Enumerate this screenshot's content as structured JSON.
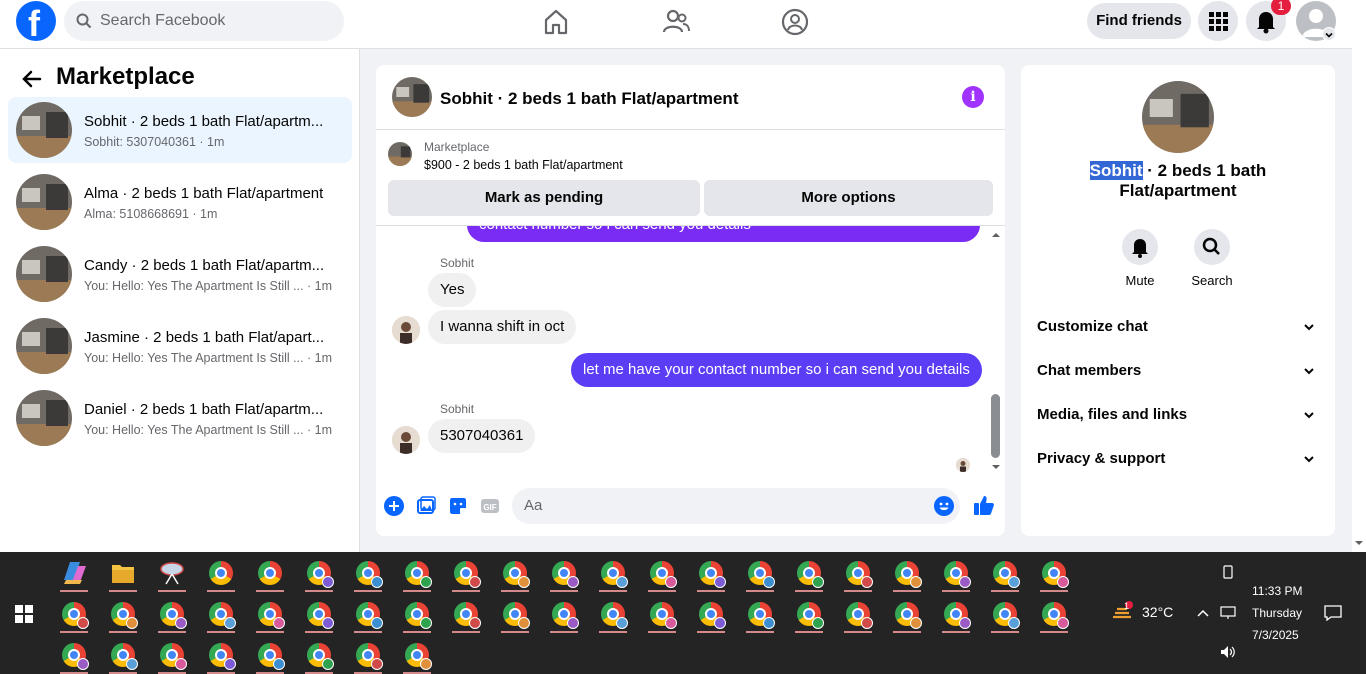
{
  "topnav": {
    "search_placeholder": "Search Facebook",
    "find_friends": "Find friends",
    "notification_count": "1"
  },
  "left": {
    "title": "Marketplace",
    "conversations": [
      {
        "name": "Sobhit · 2 beds 1 bath Flat/apartm...",
        "sub": "Sobhit: 5307040361 · 1m",
        "active": true
      },
      {
        "name": "Alma · 2 beds 1 bath Flat/apartment",
        "sub": "Alma: 5108668691 · 1m",
        "active": false
      },
      {
        "name": "Candy · 2 beds 1 bath Flat/apartm...",
        "sub": "You: Hello: Yes The Apartment Is Still ... · 1m",
        "active": false
      },
      {
        "name": "Jasmine · 2 beds 1 bath Flat/apart...",
        "sub": "You: Hello: Yes The Apartment Is Still ... · 1m",
        "active": false
      },
      {
        "name": "Daniel · 2 beds 1 bath Flat/apartm...",
        "sub": "You: Hello: Yes The Apartment Is Still ... · 1m",
        "active": false
      }
    ]
  },
  "chat": {
    "title": "Sobhit · 2 beds 1 bath Flat/apartment",
    "marketplace_label": "Marketplace",
    "listing": "$900 - 2 beds 1 bath Flat/apartment",
    "mark_pending": "Mark as pending",
    "more_options": "More options",
    "messages": {
      "cut_off": "contact number so i can send you details",
      "sender1": "Sobhit",
      "m1": "Yes",
      "m2": "I wanna shift in oct",
      "m3": "let me have your contact number so i can send you details",
      "sender2": "Sobhit",
      "m4": "5307040361"
    },
    "composer_placeholder": "Aa"
  },
  "right": {
    "name_highlight": "Sobhit",
    "name_rest": " · 2 beds 1 bath Flat/apartment",
    "mute": "Mute",
    "search": "Search",
    "rows": [
      "Customize chat",
      "Chat members",
      "Media, files and links",
      "Privacy & support"
    ]
  },
  "taskbar": {
    "temperature": "32°C",
    "weather_badge": "1",
    "time": "11:33 PM",
    "day": "Thursday",
    "date": "7/3/2025"
  },
  "colors": {
    "accent": "#0866ff",
    "outgoing_bubble": "#7a2cf5",
    "info_icon": "#a033ff"
  }
}
